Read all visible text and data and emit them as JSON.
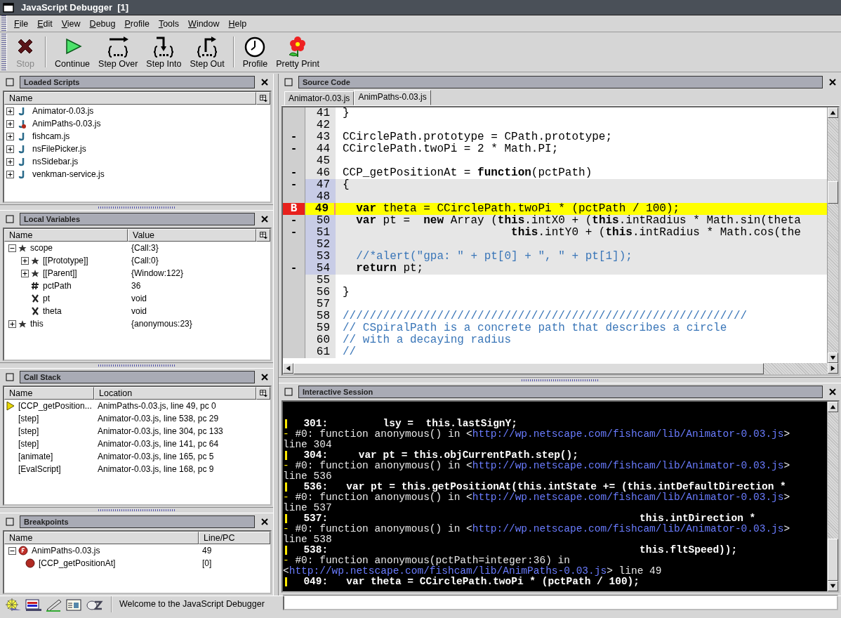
{
  "window": {
    "title": "JavaScript Debugger  [1]"
  },
  "menu": [
    {
      "label": "File"
    },
    {
      "label": "Edit"
    },
    {
      "label": "View"
    },
    {
      "label": "Debug"
    },
    {
      "label": "Profile"
    },
    {
      "label": "Tools"
    },
    {
      "label": "Window"
    },
    {
      "label": "Help"
    }
  ],
  "toolbar": {
    "groups": [
      [
        {
          "kind": "stop",
          "label": "Stop",
          "disabled": true
        }
      ],
      [
        {
          "kind": "continue",
          "label": "Continue",
          "disabled": false
        },
        {
          "kind": "step_over",
          "label": "Step Over",
          "disabled": false
        },
        {
          "kind": "step_into",
          "label": "Step Into",
          "disabled": false
        },
        {
          "kind": "step_out",
          "label": "Step Out",
          "disabled": false
        }
      ],
      [
        {
          "kind": "profile",
          "label": "Profile",
          "disabled": false
        },
        {
          "kind": "pretty_print",
          "label": "Pretty Print",
          "disabled": false
        }
      ]
    ]
  },
  "loaded_scripts": {
    "title": "Loaded Scripts",
    "columns": [
      "Name"
    ],
    "items": [
      {
        "name": "Animator-0.03.js",
        "expanded": false,
        "has_breakpoint": false
      },
      {
        "name": "AnimPaths-0.03.js",
        "expanded": false,
        "has_breakpoint": true
      },
      {
        "name": "fishcam.js",
        "expanded": false,
        "has_breakpoint": false
      },
      {
        "name": "nsFilePicker.js",
        "expanded": false,
        "has_breakpoint": false
      },
      {
        "name": "nsSidebar.js",
        "expanded": false,
        "has_breakpoint": false
      },
      {
        "name": "venkman-service.js",
        "expanded": false,
        "has_breakpoint": false
      }
    ]
  },
  "local_variables": {
    "title": "Local Variables",
    "columns": [
      "Name",
      "Value"
    ],
    "rows": [
      {
        "name": "scope",
        "value": "{Call:3}",
        "kind": "object",
        "expanded": true,
        "children": [
          {
            "name": "[[Prototype]]",
            "value": "{Call:0}",
            "kind": "object",
            "expanded": false
          },
          {
            "name": "[[Parent]]",
            "value": "{Window:122}",
            "kind": "object",
            "expanded": false
          },
          {
            "name": "pctPath",
            "value": "36",
            "kind": "number"
          },
          {
            "name": "pt",
            "value": "void",
            "kind": "void"
          },
          {
            "name": "theta",
            "value": "void",
            "kind": "void"
          }
        ]
      },
      {
        "name": "this",
        "value": "{anonymous:23}",
        "kind": "object",
        "expanded": false
      }
    ]
  },
  "call_stack": {
    "title": "Call Stack",
    "columns": [
      "Name",
      "Location"
    ],
    "rows": [
      {
        "name": "[CCP_getPosition...",
        "location": "AnimPaths-0.03.js, line 49, pc 0",
        "current": true
      },
      {
        "name": "[step]",
        "location": "Animator-0.03.js, line 538, pc 29",
        "current": false
      },
      {
        "name": "[step]",
        "location": "Animator-0.03.js, line 304, pc 133",
        "current": false
      },
      {
        "name": "[step]",
        "location": "Animator-0.03.js, line 141, pc 64",
        "current": false
      },
      {
        "name": "[animate]",
        "location": "Animator-0.03.js, line 165, pc 5",
        "current": false
      },
      {
        "name": "[EvalScript]",
        "location": "Animator-0.03.js, line 168, pc 9",
        "current": false
      }
    ]
  },
  "breakpoints": {
    "title": "Breakpoints",
    "columns": [
      "Name",
      "Line/PC"
    ],
    "rows": [
      {
        "name": "AnimPaths-0.03.js",
        "line": "49",
        "kind": "file",
        "expanded": true,
        "children": [
          {
            "name": "[CCP_getPositionAt]",
            "line": "[0]",
            "kind": "function"
          }
        ]
      }
    ]
  },
  "source": {
    "title": "Source Code",
    "tabs": [
      {
        "label": "Animator-0.03.js",
        "selected": false
      },
      {
        "label": "AnimPaths-0.03.js",
        "selected": true
      }
    ],
    "lines": [
      {
        "number": "41",
        "text": "}",
        "kind": "code",
        "in_function": false,
        "current": false,
        "breakpoint": false
      },
      {
        "number": "42",
        "in_function": false,
        "current": false,
        "breakpoint": false
      },
      {
        "number": "43",
        "margin": "-",
        "text": "CCirclePath.prototype = CPath.prototype;",
        "kind": "code",
        "in_function": false,
        "current": false,
        "breakpoint": false
      },
      {
        "number": "44",
        "margin": "-",
        "text": "CCirclePath.twoPi = 2 * Math.PI;",
        "kind": "code",
        "in_function": false,
        "current": false,
        "breakpoint": false
      },
      {
        "number": "45",
        "in_function": false,
        "current": false,
        "breakpoint": false
      },
      {
        "number": "46",
        "margin": "-",
        "text": "CCP_getPositionAt = **function**(pctPath)",
        "kind": "code",
        "in_function": false,
        "current": false,
        "breakpoint": false
      },
      {
        "number": "47",
        "margin": "-",
        "text": "{",
        "kind": "code",
        "in_function": true,
        "current": false,
        "breakpoint": false
      },
      {
        "number": "48",
        "in_function": true,
        "current": false,
        "breakpoint": false
      },
      {
        "number": "49",
        "margin": "B",
        "text": "  **var** theta = CCirclePath.twoPi * (pctPath / 100);",
        "kind": "code",
        "in_function": true,
        "current": true,
        "breakpoint": true
      },
      {
        "number": "50",
        "margin": "-",
        "text": "  **var** pt =  **new** Array (**this**.intX0 + (**this**.intRadius * Math.sin(theta",
        "kind": "code",
        "in_function": true,
        "current": false,
        "breakpoint": false
      },
      {
        "number": "51",
        "margin": "-",
        "text": "                         **this**.intY0 + (**this**.intRadius * Math.cos(the",
        "kind": "code",
        "in_function": true,
        "current": false,
        "breakpoint": false
      },
      {
        "number": "52",
        "in_function": true,
        "current": false,
        "breakpoint": false
      },
      {
        "number": "53",
        "text": "  //*alert(\"gpa: \" + pt[0] + \", \" + pt[1]);",
        "kind": "comment",
        "in_function": true,
        "current": false,
        "breakpoint": false
      },
      {
        "number": "54",
        "margin": "-",
        "text": "  **return** pt;",
        "kind": "code",
        "in_function": true,
        "current": false,
        "breakpoint": false
      },
      {
        "number": "55",
        "in_function": false,
        "current": false,
        "breakpoint": false
      },
      {
        "number": "56",
        "text": "}",
        "kind": "code",
        "in_function": false,
        "current": false,
        "breakpoint": false
      },
      {
        "number": "57",
        "in_function": false,
        "current": false,
        "breakpoint": false
      },
      {
        "number": "58",
        "text": "////////////////////////////////////////////////////////////",
        "kind": "comment",
        "in_function": false,
        "current": false,
        "breakpoint": false
      },
      {
        "number": "59",
        "text": "// CSpiralPath is a concrete path that describes a circle",
        "kind": "comment",
        "in_function": false,
        "current": false,
        "breakpoint": false
      },
      {
        "number": "60",
        "text": "// with a decaying radius",
        "kind": "comment",
        "in_function": false,
        "current": false,
        "breakpoint": false
      },
      {
        "number": "61",
        "text": "//",
        "kind": "comment",
        "in_function": false,
        "current": false,
        "breakpoint": false
      }
    ]
  },
  "session": {
    "title": "Interactive Session",
    "lines": [
      {
        "kind": "code",
        "text": "  301:         lsy =  this.lastSignY;"
      },
      {
        "kind": "trace",
        "parts": [
          {
            "kind": "marker",
            "text": "-"
          },
          {
            "kind": "plain",
            "text": " #0: function anonymous() in <"
          },
          {
            "kind": "link",
            "text": "http://wp.netscape.com/fishcam/lib/Animator-0.03.js"
          },
          {
            "kind": "plain",
            "text": ">"
          }
        ]
      },
      {
        "kind": "trace",
        "parts": [
          {
            "kind": "plain",
            "text": "line 304"
          }
        ]
      },
      {
        "kind": "code",
        "text": "  304:     var pt = this.objCurrentPath.step();"
      },
      {
        "kind": "trace",
        "parts": [
          {
            "kind": "marker",
            "text": "-"
          },
          {
            "kind": "plain",
            "text": " #0: function anonymous() in <"
          },
          {
            "kind": "link",
            "text": "http://wp.netscape.com/fishcam/lib/Animator-0.03.js"
          },
          {
            "kind": "plain",
            "text": ">"
          }
        ]
      },
      {
        "kind": "trace",
        "parts": [
          {
            "kind": "plain",
            "text": "line 536"
          }
        ]
      },
      {
        "kind": "code",
        "text": "  536:   var pt = this.getPositionAt(this.intState += (this.intDefaultDirection *"
      },
      {
        "kind": "trace",
        "parts": [
          {
            "kind": "marker",
            "text": "-"
          },
          {
            "kind": "plain",
            "text": " #0: function anonymous() in <"
          },
          {
            "kind": "link",
            "text": "http://wp.netscape.com/fishcam/lib/Animator-0.03.js"
          },
          {
            "kind": "plain",
            "text": ">"
          }
        ]
      },
      {
        "kind": "trace",
        "parts": [
          {
            "kind": "plain",
            "text": "line 537"
          }
        ]
      },
      {
        "kind": "code",
        "text": "  537:                                                   this.intDirection *"
      },
      {
        "kind": "trace",
        "parts": [
          {
            "kind": "marker",
            "text": "-"
          },
          {
            "kind": "plain",
            "text": " #0: function anonymous() in <"
          },
          {
            "kind": "link",
            "text": "http://wp.netscape.com/fishcam/lib/Animator-0.03.js"
          },
          {
            "kind": "plain",
            "text": ">"
          }
        ]
      },
      {
        "kind": "trace",
        "parts": [
          {
            "kind": "plain",
            "text": "line 538"
          }
        ]
      },
      {
        "kind": "code",
        "text": "  538:                                                   this.fltSpeed));"
      },
      {
        "kind": "trace",
        "parts": [
          {
            "kind": "marker",
            "text": "-"
          },
          {
            "kind": "plain",
            "text": " #0: function anonymous(pctPath=integer:36) in"
          }
        ]
      },
      {
        "kind": "trace",
        "parts": [
          {
            "kind": "plain",
            "text": "<"
          },
          {
            "kind": "link",
            "text": "http://wp.netscape.com/fishcam/lib/AnimPaths-0.03.js"
          },
          {
            "kind": "plain",
            "text": "> line 49"
          }
        ]
      },
      {
        "kind": "code",
        "text": "  049:   var theta = CCirclePath.twoPi * (pctPath / 100);"
      }
    ]
  },
  "status_bar": {
    "components": [
      {
        "kind": "browser"
      },
      {
        "kind": "mail"
      },
      {
        "kind": "composer"
      },
      {
        "kind": "addressbook"
      },
      {
        "kind": "chat"
      }
    ],
    "text": "Welcome to the JavaScript Debugger"
  }
}
